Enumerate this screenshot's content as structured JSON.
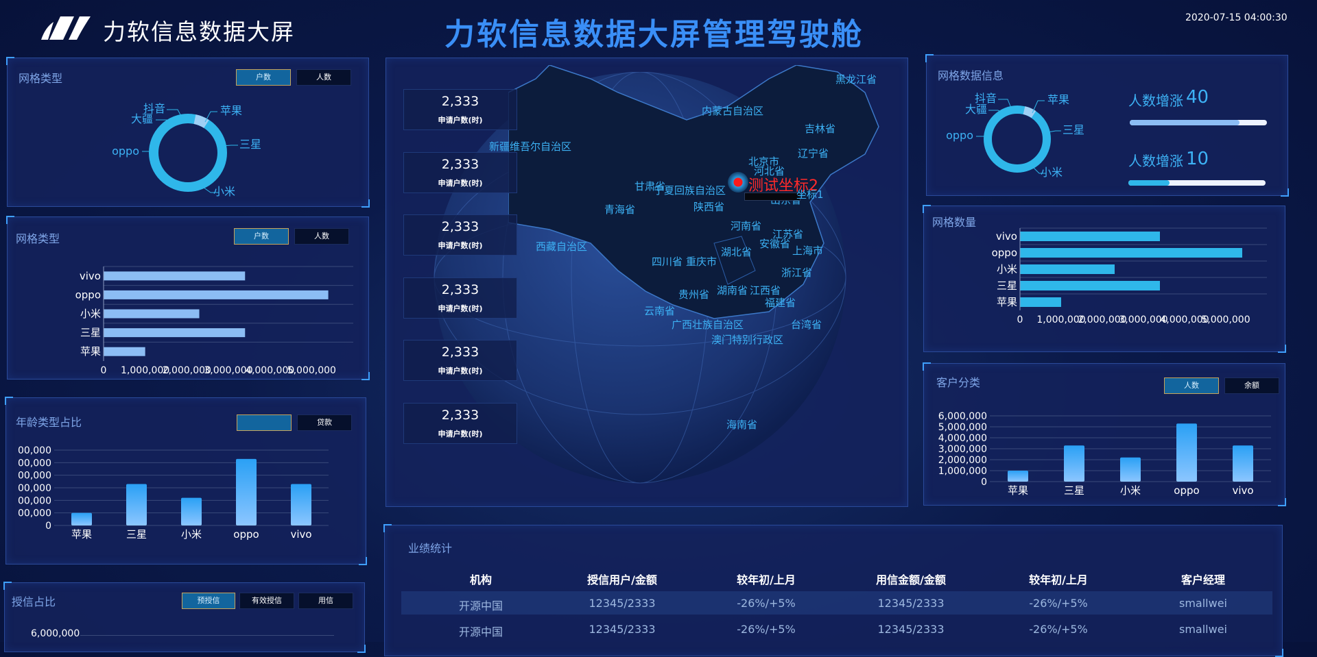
{
  "header": {
    "logo_text": "力软信息数据大屏",
    "title": "力软信息数据大屏管理驾驶舱",
    "datetime": "2020-07-15 04:00:30"
  },
  "grid_type_1": {
    "title": "网格类型",
    "tabs": [
      "户数",
      "人数"
    ],
    "donut_labels": [
      "抖音",
      "苹果",
      "大疆",
      "三星",
      "oppo",
      "小米"
    ]
  },
  "grid_type_2": {
    "title": "网格类型",
    "tabs": [
      "户数",
      "人数"
    ]
  },
  "age_type": {
    "title": "年龄类型占比",
    "tabs": [
      "",
      "贷款"
    ]
  },
  "credit": {
    "title": "授信占比",
    "tabs": [
      "预授信",
      "有效授信",
      "用信"
    ],
    "axis_top": "6,000,000"
  },
  "stats": [
    {
      "value": "2,333",
      "label": "申请户数(时)"
    },
    {
      "value": "2,333",
      "label": "申请户数(时)"
    },
    {
      "value": "2,333",
      "label": "申请户数(时)"
    },
    {
      "value": "2,333",
      "label": "申请户数(时)"
    },
    {
      "value": "2,333",
      "label": "申请户数(时)"
    },
    {
      "value": "2,333",
      "label": "申请户数(时)"
    }
  ],
  "map": {
    "marker_label": "测试坐标2",
    "marker_label_2": "坐标1",
    "provinces": [
      "黑龙江省",
      "内蒙古自治区",
      "吉林省",
      "辽宁省",
      "新疆维吾尔自治区",
      "北京市",
      "河北省",
      "宁夏回族自治区",
      "甘肃省",
      "山东省",
      "青海省",
      "陕西省",
      "河南省",
      "江苏省",
      "安徽省",
      "上海市",
      "西藏自治区",
      "四川省",
      "重庆市",
      "湖北省",
      "浙江省",
      "贵州省",
      "湖南省",
      "江西省",
      "福建省",
      "云南省",
      "广西壮族自治区",
      "台湾省",
      "澳门特别行政区",
      "海南省"
    ]
  },
  "grid_data_info": {
    "title": "网格数据信息",
    "donut_labels": [
      "抖音",
      "苹果",
      "大疆",
      "三星",
      "oppo",
      "小米"
    ],
    "growth": [
      {
        "label": "人数增涨",
        "value": "40",
        "fraction": 0.8
      },
      {
        "label": "人数增涨",
        "value": "10",
        "fraction": 0.3
      }
    ]
  },
  "grid_count": {
    "title": "网格数量"
  },
  "customer": {
    "title": "客户分类",
    "tabs": [
      "人数",
      "余额"
    ]
  },
  "performance": {
    "title": "业绩统计",
    "columns": [
      "机构",
      "授信用户/金额",
      "较年初/上月",
      "用信金额/金额",
      "较年初/上月",
      "客户经理"
    ],
    "rows": [
      [
        "开源中国",
        "12345/2333",
        "-26%/+5%",
        "12345/2333",
        "-26%/+5%",
        "smallwei"
      ],
      [
        "开源中国",
        "12345/2333",
        "-26%/+5%",
        "12345/2333",
        "-26%/+5%",
        "smallwei"
      ]
    ]
  },
  "colors": {
    "accent": "#2fb7ea",
    "bar_light": "#8cbdf4",
    "bar_blue": "#1e8ff0",
    "title_blue": "#3a8ff7"
  },
  "chart_data": [
    {
      "type": "pie",
      "title": "网格类型",
      "categories": [
        "抖音",
        "苹果",
        "大疆",
        "三星",
        "oppo",
        "小米"
      ],
      "values": [
        1,
        6,
        1,
        30,
        30,
        32
      ]
    },
    {
      "type": "bar",
      "orientation": "horizontal",
      "title": "网格类型",
      "categories": [
        "苹果",
        "三星",
        "小米",
        "oppo",
        "vivo"
      ],
      "values": [
        1000000,
        3400000,
        2300000,
        5400000,
        3400000
      ],
      "xticks": [
        "0",
        "1,000,000",
        "2,000,000",
        "3,000,000",
        "4,000,000",
        "5,000,000"
      ],
      "xlim": [
        0,
        6000000
      ]
    },
    {
      "type": "bar",
      "title": "年龄类型占比",
      "categories": [
        "苹果",
        "三星",
        "小米",
        "oppo",
        "vivo"
      ],
      "values": [
        1000000,
        3300000,
        2200000,
        5300000,
        3300000
      ],
      "yticks": [
        "0",
        "00,000",
        "00,000",
        "00,000",
        "00,000",
        "00,000",
        "00,000"
      ],
      "ylim": [
        0,
        6000000
      ]
    },
    {
      "type": "pie",
      "title": "网格数据信息",
      "categories": [
        "抖音",
        "苹果",
        "大疆",
        "三星",
        "oppo",
        "小米"
      ],
      "values": [
        1,
        6,
        1,
        30,
        30,
        32
      ]
    },
    {
      "type": "bar",
      "orientation": "horizontal",
      "title": "网格数量",
      "categories": [
        "苹果",
        "三星",
        "小米",
        "oppo",
        "vivo"
      ],
      "values": [
        1000000,
        3400000,
        2300000,
        5400000,
        3400000
      ],
      "xticks": [
        "0",
        "1,000,000",
        "2,000,000",
        "3,000,000",
        "4,000,000",
        "5,000,000"
      ],
      "xlim": [
        0,
        6000000
      ]
    },
    {
      "type": "bar",
      "title": "客户分类",
      "categories": [
        "苹果",
        "三星",
        "小米",
        "oppo",
        "vivo"
      ],
      "values": [
        1000000,
        3300000,
        2200000,
        5300000,
        3300000
      ],
      "yticks": [
        "0",
        "1,000,000",
        "2,000,000",
        "3,000,000",
        "4,000,000",
        "5,000,000",
        "6,000,000"
      ],
      "ylim": [
        0,
        6000000
      ]
    }
  ]
}
